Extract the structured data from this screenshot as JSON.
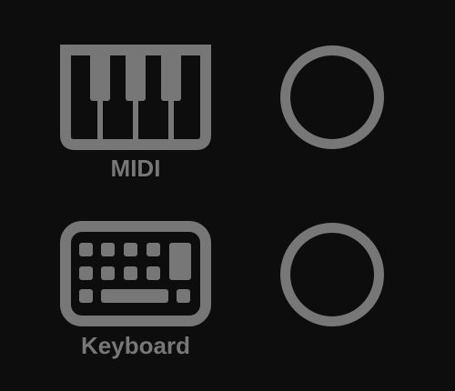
{
  "inputs": [
    {
      "label": "MIDI",
      "icon": "piano-keys-icon",
      "selected": false
    },
    {
      "label": "Keyboard",
      "icon": "computer-keyboard-icon",
      "selected": false
    }
  ],
  "colors": {
    "background": "#0d0d0d",
    "foreground": "#777777"
  }
}
